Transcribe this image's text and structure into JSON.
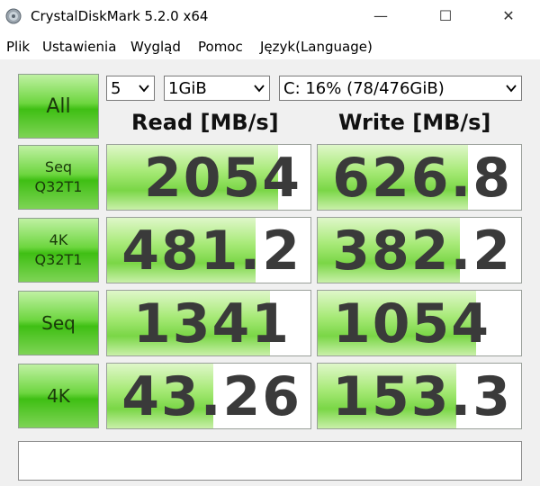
{
  "window": {
    "title": "CrystalDiskMark 5.2.0 x64",
    "minimize_glyph": "—",
    "maximize_glyph": "☐",
    "close_glyph": "✕"
  },
  "menu": [
    "Plik",
    "Ustawienia",
    "Wygląd",
    "Pomoc",
    "Język(Language)"
  ],
  "controls": {
    "all_label": "All",
    "test_count": "5",
    "test_size": "1GiB",
    "drive": "C: 16% (78/476GiB)"
  },
  "headers": {
    "read": "Read [MB/s]",
    "write": "Write [MB/s]"
  },
  "tests": [
    {
      "label_line1": "Seq",
      "label_line2": "Q32T1",
      "read": "2054",
      "write": "626.8",
      "read_level": 0.84,
      "write_level": 0.74
    },
    {
      "label_line1": "4K",
      "label_line2": "Q32T1",
      "read": "481.2",
      "write": "382.2",
      "read_level": 0.73,
      "write_level": 0.7
    },
    {
      "label_line1": "Seq",
      "label_line2": "",
      "read": "1341",
      "write": "1054",
      "read_level": 0.8,
      "write_level": 0.78
    },
    {
      "label_line1": "4K",
      "label_line2": "",
      "read": "43.26",
      "write": "153.3",
      "read_level": 0.52,
      "write_level": 0.68
    }
  ],
  "colors": {
    "button_green": "#4cc41e",
    "bar_green": "#8fdd5a",
    "value_text": "#3a3a3a"
  },
  "icons": {
    "app": "crystaldiskmark-disc-icon",
    "dropdown": "chevron-down-icon"
  }
}
